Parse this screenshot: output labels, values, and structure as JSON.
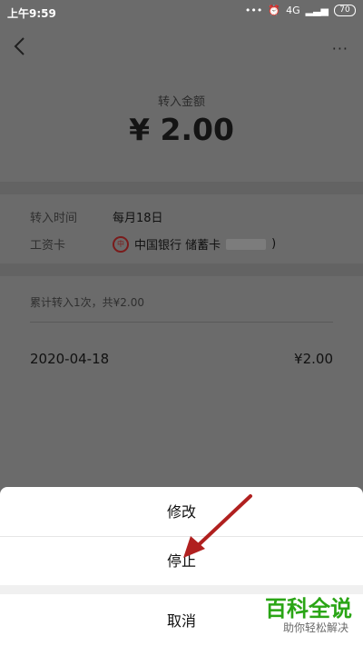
{
  "status_bar": {
    "time": "上午9:59",
    "network": "4G",
    "battery": "70"
  },
  "header": {
    "more": "···"
  },
  "amount": {
    "label": "转入金额",
    "value": "¥ 2.00"
  },
  "details": {
    "transfer_time_label": "转入时间",
    "transfer_time_value": "每月18日",
    "card_label": "工资卡",
    "card_value": "中国银行 储蓄卡",
    "card_suffix": ")"
  },
  "summary": {
    "text": "累计转入1次，共¥2.00"
  },
  "records": [
    {
      "date": "2020-04-18",
      "amount": "¥2.00"
    }
  ],
  "action_sheet": {
    "modify": "修改",
    "stop": "停止",
    "cancel": "取消"
  },
  "watermark": {
    "title": "百科全说",
    "subtitle": "助你轻松解决"
  },
  "colors": {
    "overlay": "#6b6b6b",
    "sheet": "#ffffff",
    "arrow": "#b0201f",
    "watermark": "#2aa515"
  }
}
